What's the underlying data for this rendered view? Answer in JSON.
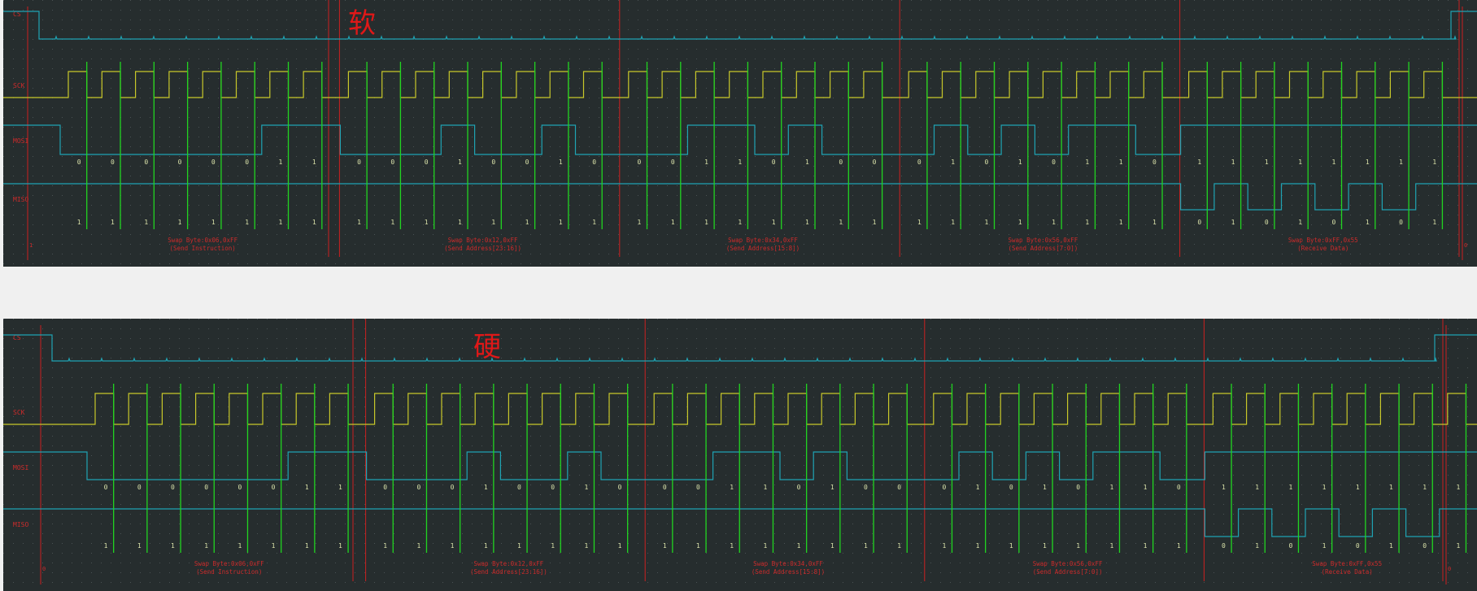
{
  "colors": {
    "background": "#262d2e",
    "page": "#f0f0f0",
    "grid_dots": "#4a5254",
    "cs_trace": "#1fa3b3",
    "sck_trace": "#c8c82a",
    "mosi_trace": "#1fa3b3",
    "miso_trace": "#1fa3b3",
    "sample_markers": "#21d421",
    "byte_separators": "#cc2020",
    "labels": "#cc2b2b",
    "bit_values": "#d8e0a8"
  },
  "captures": [
    {
      "title": "软",
      "channels": [
        "CS",
        "SCK",
        "MOSI",
        "MISO"
      ],
      "start_marker": "1",
      "end_marker": "0",
      "bytes": [
        {
          "annotation": "Swap Byte:0x06,0xFF",
          "subtitle": "(Send Instruction)",
          "mosi_bits": [
            "0",
            "0",
            "0",
            "0",
            "0",
            "0",
            "1",
            "1"
          ],
          "miso_bits": [
            "1",
            "1",
            "1",
            "1",
            "1",
            "1",
            "1",
            "1"
          ]
        },
        {
          "annotation": "Swap Byte:0x12,0xFF",
          "subtitle": "(Send Address[23:16])",
          "mosi_bits": [
            "0",
            "0",
            "0",
            "1",
            "0",
            "0",
            "1",
            "0"
          ],
          "miso_bits": [
            "1",
            "1",
            "1",
            "1",
            "1",
            "1",
            "1",
            "1"
          ]
        },
        {
          "annotation": "Swap Byte:0x34,0xFF",
          "subtitle": "(Send Address[15:8])",
          "mosi_bits": [
            "0",
            "0",
            "1",
            "1",
            "0",
            "1",
            "0",
            "0"
          ],
          "miso_bits": [
            "1",
            "1",
            "1",
            "1",
            "1",
            "1",
            "1",
            "1"
          ]
        },
        {
          "annotation": "Swap Byte:0x56,0xFF",
          "subtitle": "(Send Address[7:0])",
          "mosi_bits": [
            "0",
            "1",
            "0",
            "1",
            "0",
            "1",
            "1",
            "0"
          ],
          "miso_bits": [
            "1",
            "1",
            "1",
            "1",
            "1",
            "1",
            "1",
            "1"
          ]
        },
        {
          "annotation": "Swap Byte:0xFF,0x55",
          "subtitle": "(Receive Data)",
          "mosi_bits": [
            "1",
            "1",
            "1",
            "1",
            "1",
            "1",
            "1",
            "1"
          ],
          "miso_bits": [
            "0",
            "1",
            "0",
            "1",
            "0",
            "1",
            "0",
            "1"
          ]
        }
      ]
    },
    {
      "title": "硬",
      "channels": [
        "CS",
        "SCK",
        "MOSI",
        "MISO"
      ],
      "start_marker": "0",
      "end_marker": "0",
      "bytes": [
        {
          "annotation": "Swap Byte:0x06,0xFF",
          "subtitle": "(Send Instruction)",
          "mosi_bits": [
            "0",
            "0",
            "0",
            "0",
            "0",
            "0",
            "1",
            "1"
          ],
          "miso_bits": [
            "1",
            "1",
            "1",
            "1",
            "1",
            "1",
            "1",
            "1"
          ]
        },
        {
          "annotation": "Swap Byte:0x12,0xFF",
          "subtitle": "(Send Address[23:16])",
          "mosi_bits": [
            "0",
            "0",
            "0",
            "1",
            "0",
            "0",
            "1",
            "0"
          ],
          "miso_bits": [
            "1",
            "1",
            "1",
            "1",
            "1",
            "1",
            "1",
            "1"
          ]
        },
        {
          "annotation": "Swap Byte:0x34,0xFF",
          "subtitle": "(Send Address[15:8])",
          "mosi_bits": [
            "0",
            "0",
            "1",
            "1",
            "0",
            "1",
            "0",
            "0"
          ],
          "miso_bits": [
            "1",
            "1",
            "1",
            "1",
            "1",
            "1",
            "1",
            "1"
          ]
        },
        {
          "annotation": "Swap Byte:0x56,0xFF",
          "subtitle": "(Send Address[7:0])",
          "mosi_bits": [
            "0",
            "1",
            "0",
            "1",
            "0",
            "1",
            "1",
            "0"
          ],
          "miso_bits": [
            "1",
            "1",
            "1",
            "1",
            "1",
            "1",
            "1",
            "1"
          ]
        },
        {
          "annotation": "Swap Byte:0xFF,0x55",
          "subtitle": "(Receive Data)",
          "mosi_bits": [
            "1",
            "1",
            "1",
            "1",
            "1",
            "1",
            "1",
            "1"
          ],
          "miso_bits": [
            "0",
            "1",
            "0",
            "1",
            "0",
            "1",
            "0",
            "1"
          ]
        }
      ]
    }
  ]
}
